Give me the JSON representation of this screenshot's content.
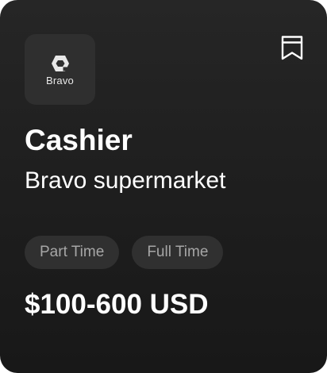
{
  "job": {
    "logo_text": "Bravo",
    "logo_icon": "hexagon-logo-icon",
    "bookmark_icon": "bookmark-icon",
    "title": "Cashier",
    "company": "Bravo supermarket",
    "tags": [
      "Part Time",
      "Full Time"
    ],
    "salary": "$100-600 USD"
  },
  "colors": {
    "card_background": "#1f1f1f",
    "logo_background": "#2f2f2f",
    "tag_background": "#303030",
    "tag_text": "#a6a6a6",
    "primary_text": "#ffffff"
  }
}
